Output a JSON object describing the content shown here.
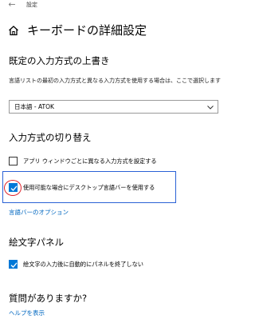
{
  "window": {
    "title": "設定",
    "back_icon": "back-arrow-icon"
  },
  "header": {
    "home_icon": "home-icon",
    "title": "キーボードの詳細設定"
  },
  "override_section": {
    "title": "既定の入力方式の上書き",
    "description": "言語リストの最初の入力方式と異なる入力方式を使用する場合は、ここで選択します",
    "select": {
      "value": "日本語 - ATOK"
    }
  },
  "switch_section": {
    "title": "入力方式の切り替え",
    "checkboxes": [
      {
        "label": "アプリ ウィンドウごとに異なる入力方式を設定する",
        "checked": false
      },
      {
        "label": "使用可能な場合にデスクトップ言語バーを使用する",
        "checked": true
      }
    ],
    "link": "言語バーのオプション"
  },
  "emoji_section": {
    "title": "絵文字パネル",
    "checkbox": {
      "label": "絵文字の入力後に自動的にパネルを終了しない",
      "checked": true
    }
  },
  "help_section": {
    "title": "質問がありますか?",
    "link": "ヘルプを表示"
  },
  "colors": {
    "accent": "#0078d7",
    "link": "#0067c0",
    "highlight_border": "#2b62d6",
    "annotation_circle": "#e0242c"
  }
}
